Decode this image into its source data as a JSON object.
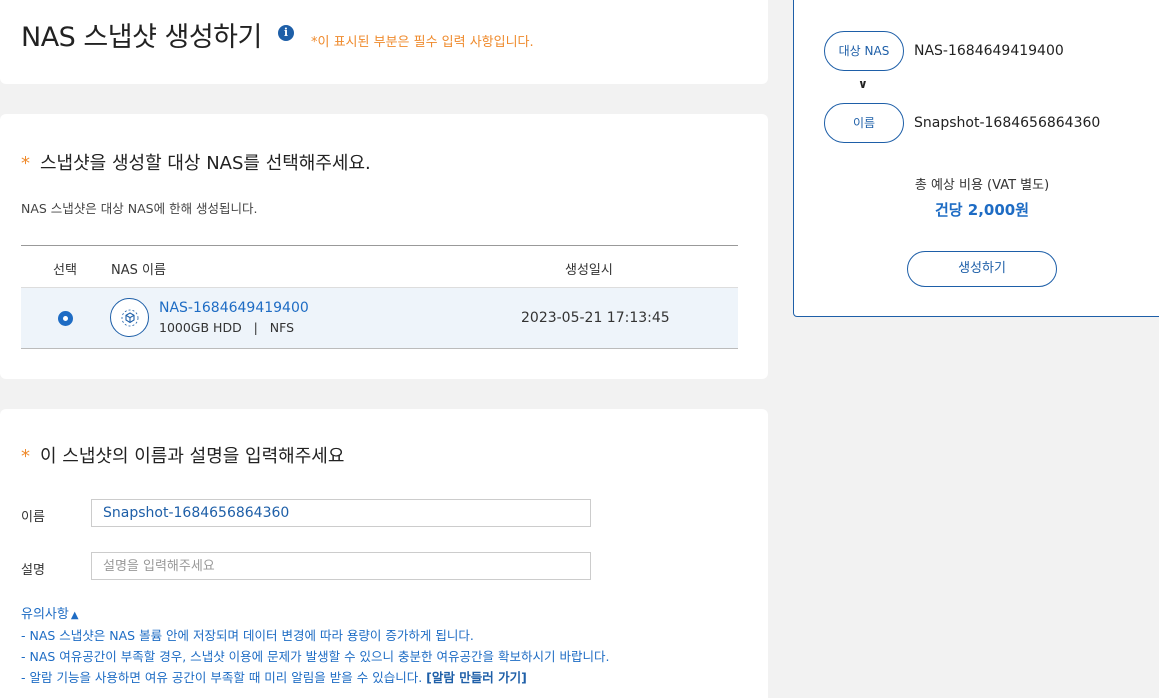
{
  "header": {
    "title": "NAS 스냅샷 생성하기",
    "info_icon": "info-icon",
    "required_note": "*이 표시된 부분은 필수 입력 사항입니다."
  },
  "select_section": {
    "title": "스냅샷을 생성할 대상 NAS를 선택해주세요.",
    "description": "NAS 스냅샷은 대상 NAS에 한해 생성됩니다.",
    "columns": [
      "선택",
      "NAS 이름",
      "생성일시"
    ],
    "rows": [
      {
        "selected": true,
        "name": "NAS-1684649419400",
        "spec": "1000GB HDD   |   NFS",
        "created": "2023-05-21 17:13:45",
        "icon": "nas-volume-icon"
      }
    ]
  },
  "info_section": {
    "title": "이 스냅샷의 이름과 설명을 입력해주세요",
    "name_label": "이름",
    "name_value": "Snapshot-1684656864360",
    "desc_label": "설명",
    "desc_placeholder": "설명을 입력해주세요",
    "notes_title": "유의사항",
    "notes": [
      "- NAS 스냅샷은 NAS 볼륨 안에 저장되며 데이터 변경에 따라 용량이 증가하게 됩니다.",
      "- NAS 여유공간이 부족할 경우, 스냅샷 이용에 문제가 발생할 수 있으니 충분한 여유공간을 확보하시기 바랍니다.",
      "- 알람 기능을 사용하면 여유 공간이 부족할 때 미리 알림을 받을 수 있습니다."
    ],
    "alarm_link": "[알람 만들러 가기]"
  },
  "summary": {
    "target_label": "대상 NAS",
    "target_value": "NAS-1684649419400",
    "name_label": "이름",
    "name_value": "Snapshot-1684656864360",
    "cost_label": "총 예상 비용 (VAT 별도)",
    "cost_value": "건당 2,000원",
    "create_button": "생성하기"
  },
  "colors": {
    "accent": "#1e6cc4",
    "required": "#ef8a2c",
    "selected_row": "#eef4fa"
  }
}
